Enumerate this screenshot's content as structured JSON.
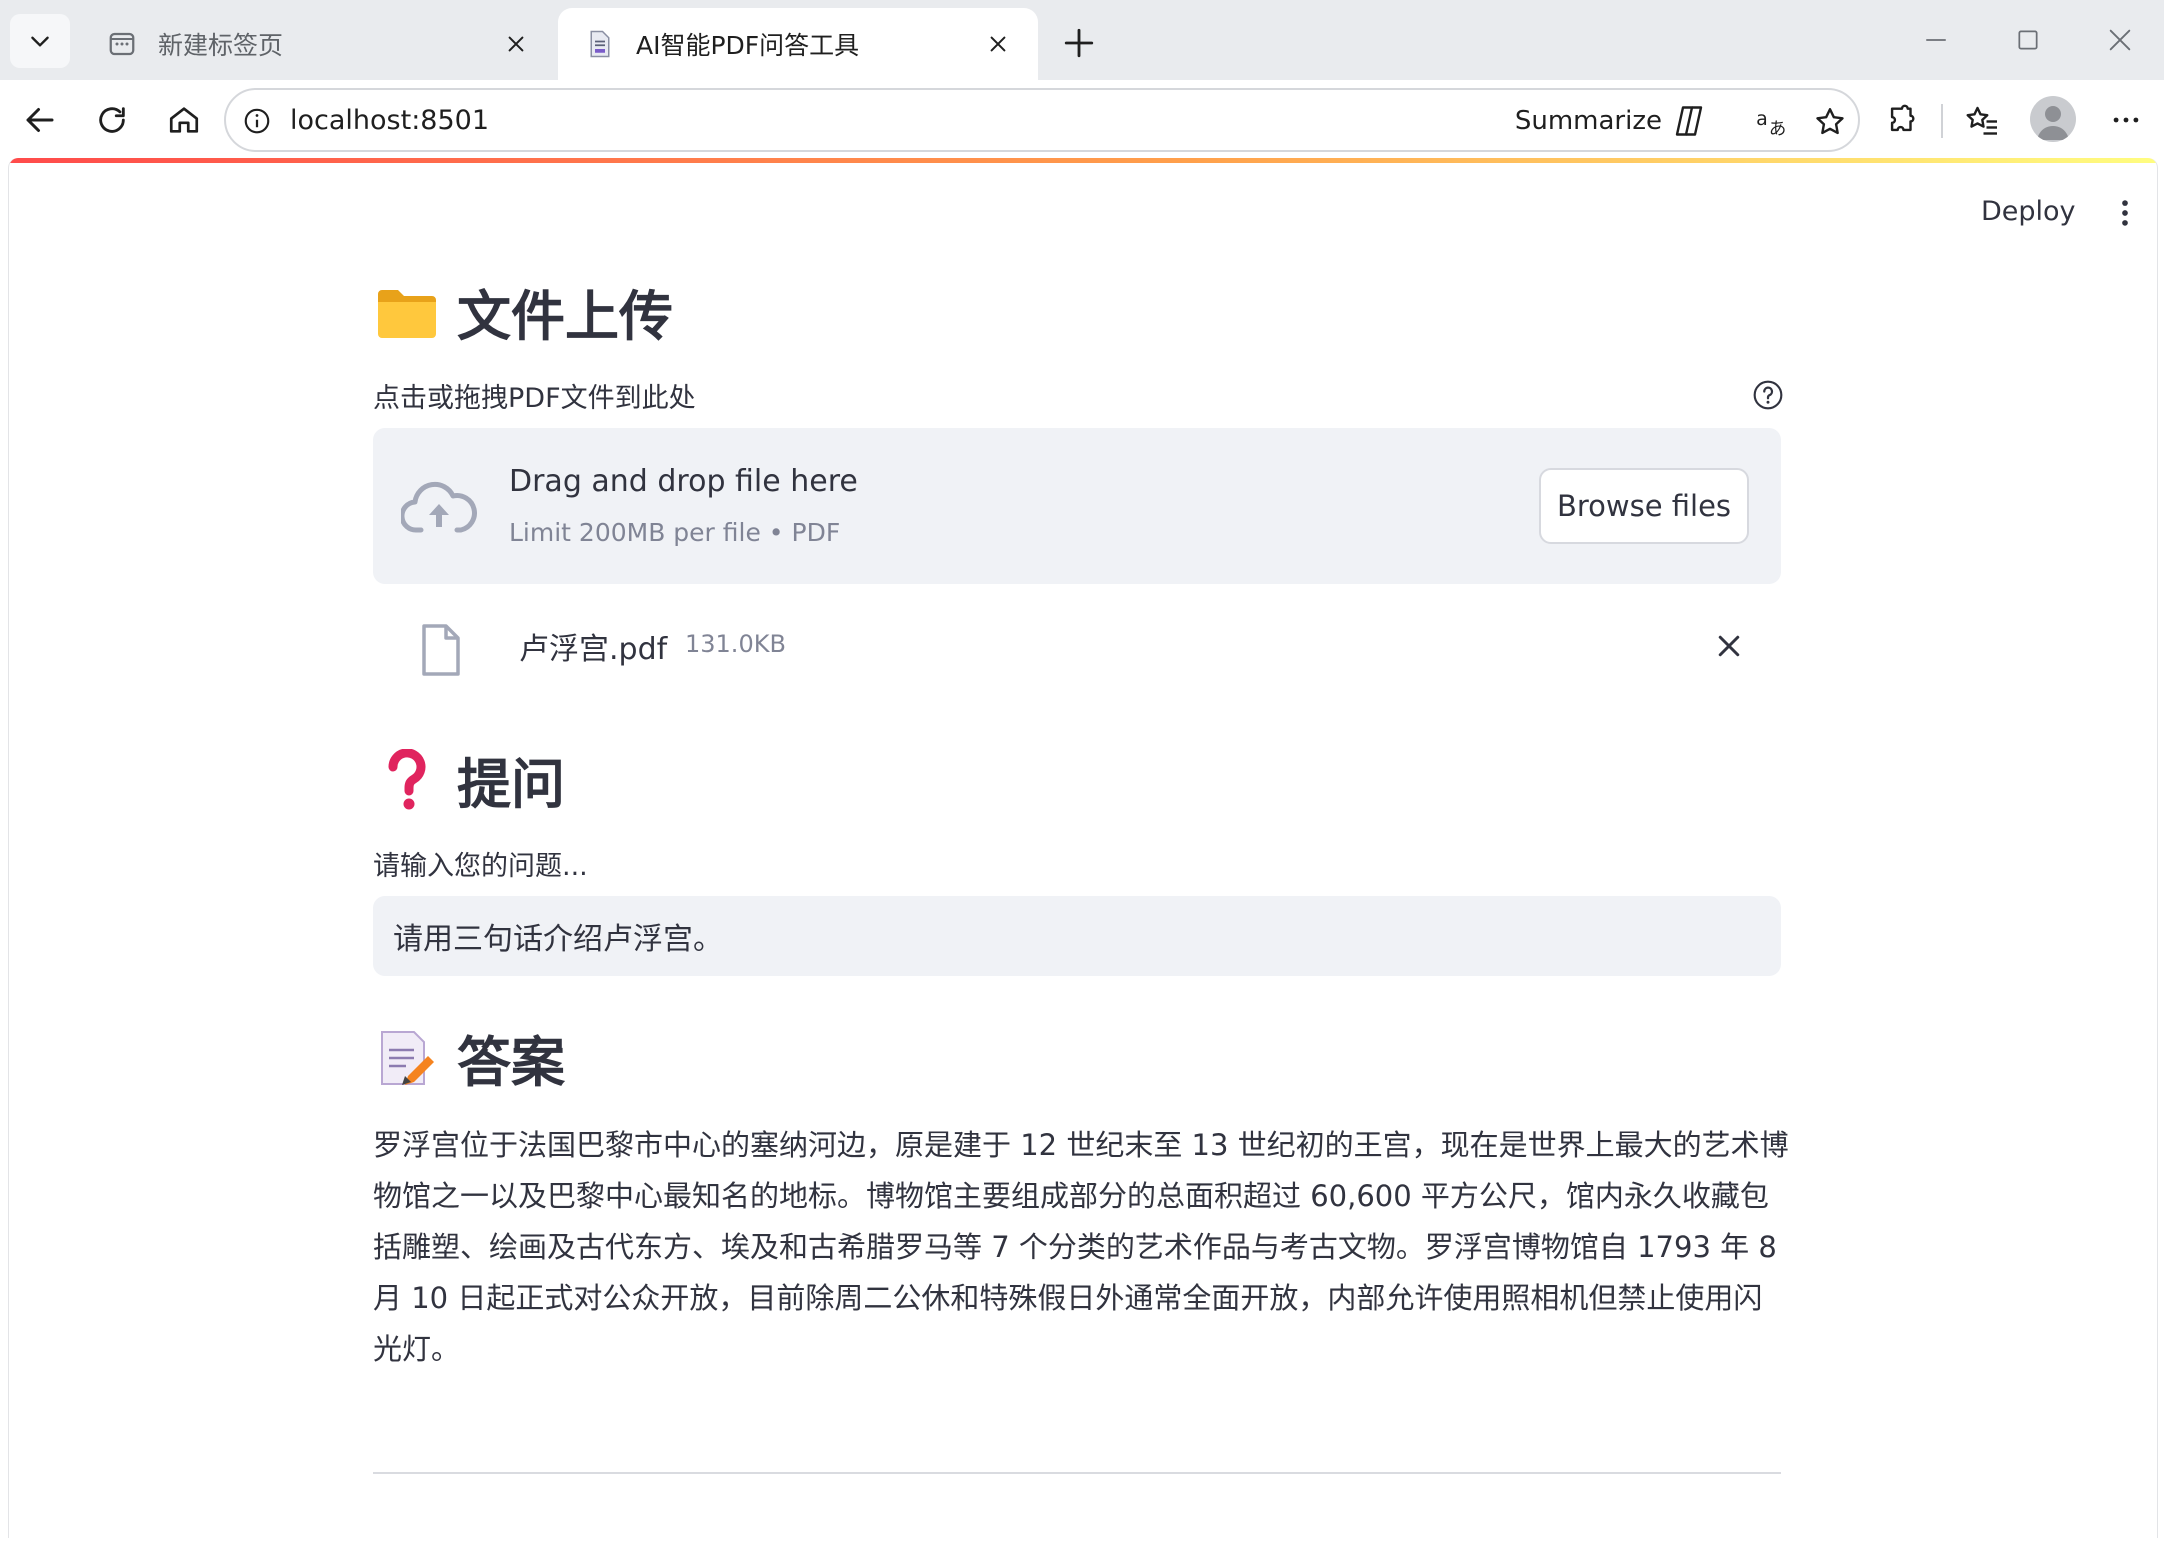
{
  "browser": {
    "tabs": [
      {
        "title": "新建标签页",
        "active": false
      },
      {
        "title": "AI智能PDF问答工具",
        "active": true
      }
    ],
    "address": "localhost:8501",
    "summarize_label": "Summarize"
  },
  "app": {
    "deploy_label": "Deploy",
    "upload_section": {
      "heading": "文件上传",
      "label": "点击或拖拽PDF文件到此处",
      "dropzone_title": "Drag and drop file here",
      "dropzone_limit": "Limit 200MB per file • PDF",
      "browse_label": "Browse files",
      "file": {
        "name": "卢浮宫.pdf",
        "size": "131.0KB"
      }
    },
    "question_section": {
      "heading": "提问",
      "label": "请输入您的问题...",
      "value": "请用三句话介绍卢浮宫。"
    },
    "answer_section": {
      "heading": "答案",
      "text": "罗浮宫位于法国巴黎市中心的塞纳河边，原是建于 12 世纪末至 13 世纪初的王宫，现在是世界上最大的艺术博物馆之一以及巴黎中心最知名的地标。博物馆主要组成部分的总面积超过 60,600 平方公尺，馆内永久收藏包括雕塑、绘画及古代东方、埃及和古希腊罗马等 7 个分类的艺术作品与考古文物。罗浮宫博物馆自 1793 年 8 月 10 日起正式对公众开放，目前除周二公休和特殊假日外通常全面开放，内部允许使用照相机但禁止使用闪光灯。"
    }
  },
  "colors": {
    "accent_gradient_start": "#ff4b4b",
    "accent_gradient_end": "#fffd80",
    "text": "#31333f",
    "muted": "#808495",
    "input_bg": "#f0f2f6"
  }
}
